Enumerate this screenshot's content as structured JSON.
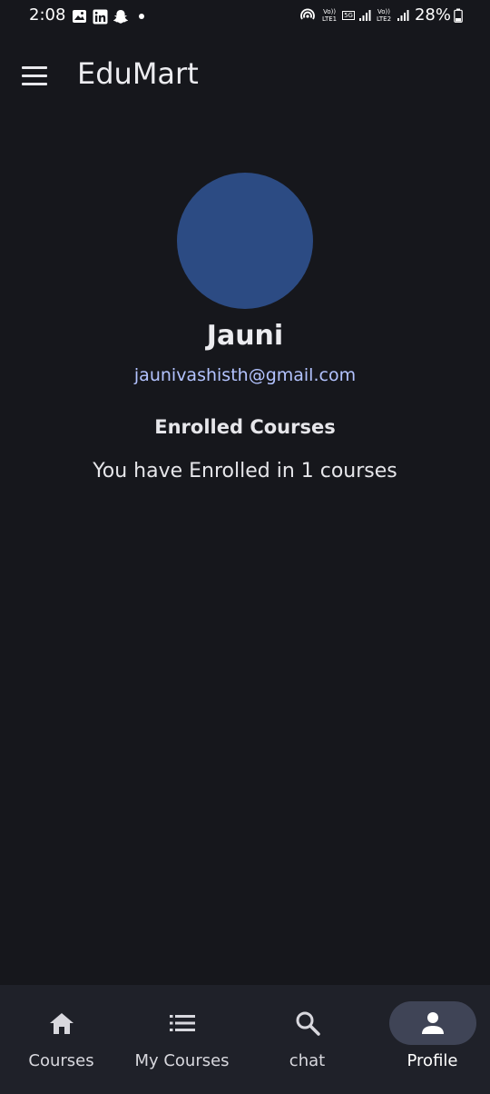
{
  "status_bar": {
    "time": "2:08",
    "battery": "28%",
    "network": {
      "volte1": "Vo)) LTE1",
      "fiveg": "5G",
      "volte2": "Vo)) LTE2"
    },
    "icons": [
      "gallery-icon",
      "linkedin-icon",
      "snapchat-icon",
      "hotspot-icon",
      "signal-icon",
      "battery-icon"
    ]
  },
  "app_bar": {
    "title": "EduMart"
  },
  "profile": {
    "name": "Jauni",
    "email": "jaunivashisth@gmail.com",
    "avatar_color": "#2c4b83",
    "enrolled_heading": "Enrolled Courses",
    "enrolled_text": "You have Enrolled in 1 courses"
  },
  "bottom_nav": {
    "items": [
      {
        "label": "Courses",
        "icon": "home-icon"
      },
      {
        "label": "My Courses",
        "icon": "list-icon"
      },
      {
        "label": "chat",
        "icon": "search-icon"
      },
      {
        "label": "Profile",
        "icon": "person-icon",
        "active": true
      }
    ]
  },
  "colors": {
    "background": "#16171c",
    "nav_background": "#1f2129",
    "active_pill": "#3f4456",
    "email_link": "#b3c3ff"
  }
}
